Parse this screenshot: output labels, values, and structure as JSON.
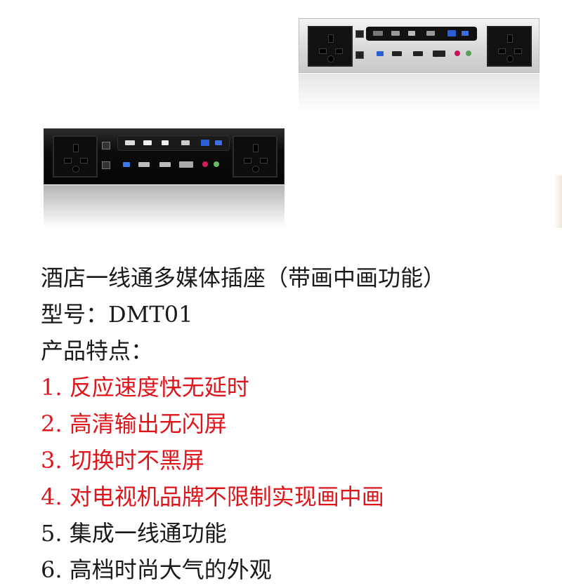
{
  "product_images": {
    "silver_panel": {
      "finish": "silver",
      "socket_count": 2
    },
    "black_panel": {
      "finish": "black",
      "socket_count": 2
    }
  },
  "text": {
    "title": "酒店一线通多媒体插座（带画中画功能）",
    "model": "型号：DMT01",
    "features_heading": "产品特点：",
    "features": [
      {
        "label": "1. 反应速度快无延时",
        "color": "#e0141b"
      },
      {
        "label": "2. 高清输出无闪屏",
        "color": "#e0141b"
      },
      {
        "label": "3. 切换时不黑屏",
        "color": "#e0141b"
      },
      {
        "label": "4. 对电视机品牌不限制实现画中画",
        "color": "#e0141b"
      },
      {
        "label": "5. 集成一线通功能",
        "color": "#1a1a1a"
      },
      {
        "label": "6. 高档时尚大气的外观",
        "color": "#1a1a1a"
      }
    ]
  },
  "colors": {
    "feature_red": "#e0141b",
    "text_black": "#1a1a1a",
    "accent_blue": "#2a5fd8"
  }
}
